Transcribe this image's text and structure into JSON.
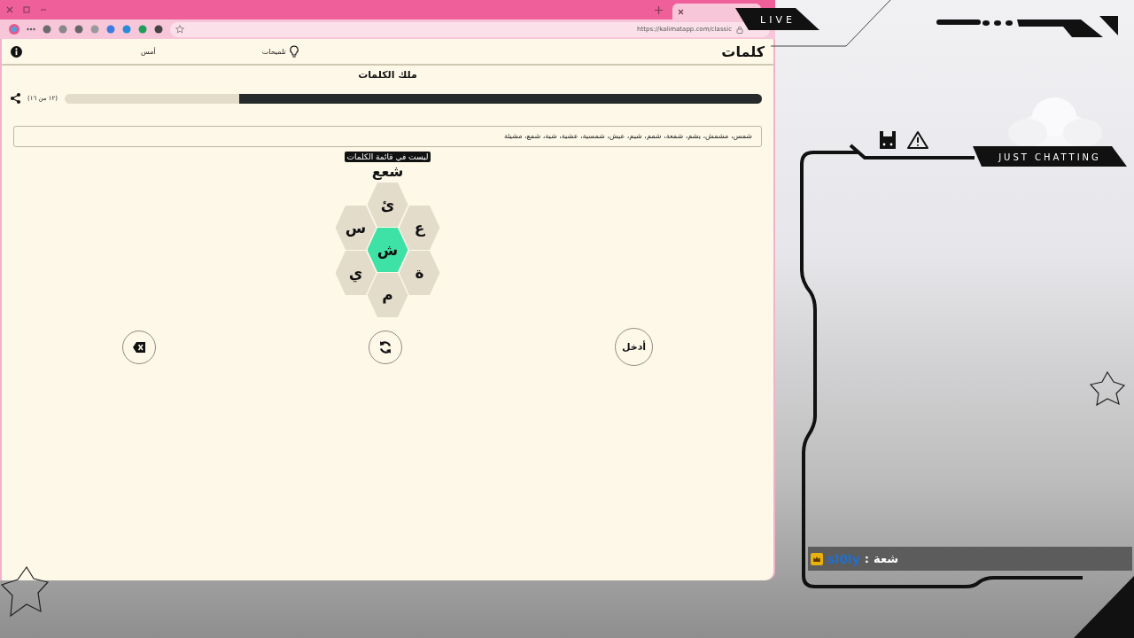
{
  "browser": {
    "url": "https://kalimatapp.com/classic"
  },
  "app": {
    "title": "كلمات",
    "nav": [
      {
        "kind": "hints",
        "label": "تلميحات"
      },
      {
        "kind": "yesterday",
        "label": "أمس"
      }
    ],
    "subtitle": "ملك الكلمات",
    "progress": {
      "level": 0.75,
      "reading": "(١٢ من ١٦)"
    },
    "found_words": "شمس، مشمش، يشم، شمعة، شمم، شيم، عيش، شمسية، عشية، شية، شمع، مشيئة",
    "tooltip": "ليست في قائمة الكلمات",
    "current_word": "شعع",
    "letters": [
      {
        "letter": "ئ",
        "kind": "outer"
      },
      {
        "letter": "ع",
        "kind": "outer"
      },
      {
        "letter": "س",
        "kind": "outer"
      },
      {
        "letter": "ش",
        "kind": "center"
      },
      {
        "letter": "ة",
        "kind": "outer"
      },
      {
        "letter": "ي",
        "kind": "outer"
      },
      {
        "letter": "م",
        "kind": "outer"
      }
    ],
    "buttons": [
      {
        "kind": "enter",
        "label": "أدخل"
      },
      {
        "kind": "shuffle"
      },
      {
        "kind": "delete"
      }
    ]
  },
  "overlay": {
    "live": "LIVE",
    "category": "JUST CHATTING",
    "chat": [
      {
        "user": "sl0ly",
        "separator": ":",
        "message": "شعة"
      }
    ]
  }
}
